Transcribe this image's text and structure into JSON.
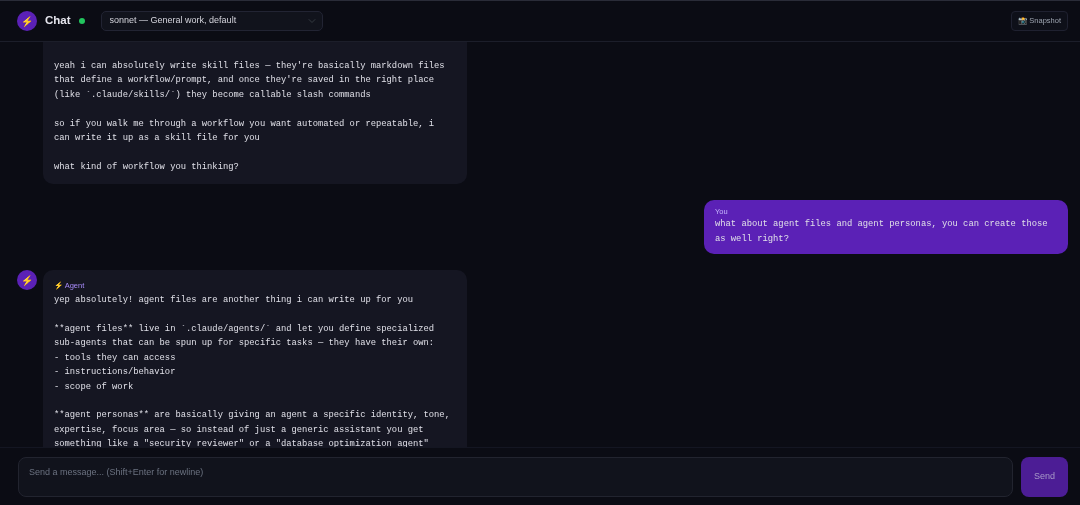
{
  "header": {
    "logo_glyph": "⚡",
    "title": "Chat",
    "online": true,
    "model_select": "sonnet — General work, default",
    "snapshot_button": {
      "glyph": "📸",
      "label": "Snapshot"
    }
  },
  "messages": [
    {
      "kind": "agent",
      "show_avatar": false,
      "text": "yeah i can absolutely write skill files — they're basically markdown files\nthat define a workflow/prompt, and once they're saved in the right place\n(like `.claude/skills/`) they become callable slash commands\n\nso if you walk me through a workflow you want automated or repeatable, i\ncan write it up as a skill file for you\n\nwhat kind of workflow you thinking?"
    },
    {
      "kind": "user",
      "label": "You",
      "text": "what about agent files and agent personas, you can create those\nas well right?"
    },
    {
      "kind": "agent",
      "show_avatar": true,
      "avatar_glyph": "⚡",
      "label": "⚡ Agent",
      "text": "yep absolutely! agent files are another thing i can write up for you\n\n**agent files** live in `.claude/agents/` and let you define specialized\nsub-agents that can be spun up for specific tasks — they have their own:\n- tools they can access\n- instructions/behavior\n- scope of work\n\n**agent personas** are basically giving an agent a specific identity, tone,\nexpertise, focus area — so instead of just a generic assistant you get\nsomething like a \"security reviewer\" or a \"database optimization agent\""
    }
  ],
  "composer": {
    "placeholder": "Send a message... (Shift+Enter for newline)",
    "send_label": "Send",
    "send_disabled": true
  }
}
